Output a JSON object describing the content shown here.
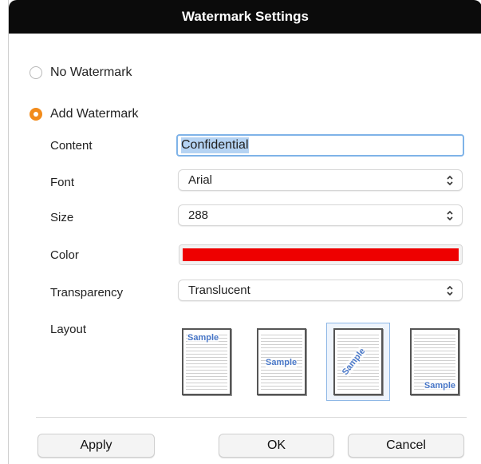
{
  "dialog": {
    "title": "Watermark Settings"
  },
  "options": {
    "no_watermark": {
      "label": "No Watermark",
      "selected": false
    },
    "add_watermark": {
      "label": "Add Watermark",
      "selected": true
    }
  },
  "content": {
    "label": "Content",
    "value": "Confidential"
  },
  "font": {
    "label": "Font",
    "value": "Arial"
  },
  "size": {
    "label": "Size",
    "value": "288"
  },
  "color": {
    "label": "Color",
    "value": "#ee0000"
  },
  "transparency": {
    "label": "Transparency",
    "value": "Translucent"
  },
  "layout": {
    "label": "Layout",
    "options": [
      {
        "name": "top-left",
        "sample": "Sample",
        "selected": false
      },
      {
        "name": "center",
        "sample": "Sample",
        "selected": false
      },
      {
        "name": "diagonal",
        "sample": "Sample",
        "selected": true
      },
      {
        "name": "bottom-right",
        "sample": "Sample",
        "selected": false
      }
    ]
  },
  "buttons": {
    "apply": "Apply",
    "ok": "OK",
    "cancel": "Cancel"
  },
  "colors": {
    "accent": "#f28b1b",
    "focus": "#7fb3e8",
    "sample_text": "#4a78c8"
  },
  "icons": {
    "select_chevron": "chevron-up-down-icon"
  }
}
